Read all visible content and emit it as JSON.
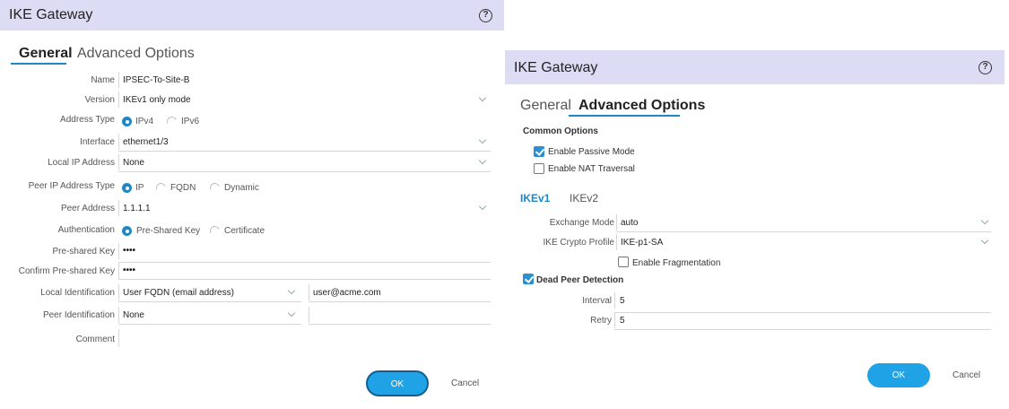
{
  "general_dialog": {
    "title": "IKE Gateway",
    "help_icon": "?",
    "tabs": [
      "General",
      "Advanced Options"
    ],
    "active_tab": "General",
    "fields": {
      "name": {
        "label": "Name",
        "value": "IPSEC-To-Site-B"
      },
      "version": {
        "label": "Version",
        "value": "IKEv1 only mode"
      },
      "address_type": {
        "label": "Address Type",
        "options": [
          "IPv4",
          "IPv6"
        ],
        "selected": "IPv4"
      },
      "interface": {
        "label": "Interface",
        "value": "ethernet1/3"
      },
      "local_ip": {
        "label": "Local IP Address",
        "value": "None"
      },
      "peer_ip_type": {
        "label": "Peer IP Address Type",
        "options": [
          "IP",
          "FQDN",
          "Dynamic"
        ],
        "selected": "IP"
      },
      "peer_address": {
        "label": "Peer Address",
        "value": "1.1.1.1"
      },
      "authentication": {
        "label": "Authentication",
        "options": [
          "Pre-Shared Key",
          "Certificate"
        ],
        "selected": "Pre-Shared Key"
      },
      "psk": {
        "label": "Pre-shared Key",
        "value": "••••"
      },
      "confirm_psk": {
        "label": "Confirm Pre-shared Key",
        "value": "••••"
      },
      "local_id": {
        "label": "Local Identification",
        "type_value": "User FQDN (email address)",
        "value": "user@acme.com"
      },
      "peer_id": {
        "label": "Peer Identification",
        "type_value": "None",
        "value": ""
      },
      "comment": {
        "label": "Comment",
        "value": ""
      }
    },
    "ok_label": "OK",
    "cancel_label": "Cancel"
  },
  "advanced_dialog": {
    "title": "IKE Gateway",
    "help_icon": "?",
    "tabs": [
      "General",
      "Advanced Options"
    ],
    "active_tab": "Advanced Options",
    "common_options": {
      "heading": "Common Options",
      "passive_mode": {
        "label": "Enable Passive Mode",
        "checked": true
      },
      "nat_traversal": {
        "label": "Enable NAT Traversal",
        "checked": false
      }
    },
    "version_tabs": [
      "IKEv1",
      "IKEv2"
    ],
    "active_version_tab": "IKEv1",
    "exchange_mode": {
      "label": "Exchange Mode",
      "value": "auto"
    },
    "crypto_profile": {
      "label": "IKE Crypto Profile",
      "value": "IKE-p1-SA"
    },
    "fragmentation": {
      "label": "Enable Fragmentation",
      "checked": false
    },
    "dead_peer": {
      "label": "Dead Peer Detection",
      "checked": true
    },
    "interval": {
      "label": "Interval",
      "value": "5"
    },
    "retry": {
      "label": "Retry",
      "value": "5"
    },
    "ok_label": "OK",
    "cancel_label": "Cancel"
  },
  "colors": {
    "accent": "#1e88c7",
    "titlebar": "#dcdcf4",
    "ok_button": "#1fa3e6"
  }
}
